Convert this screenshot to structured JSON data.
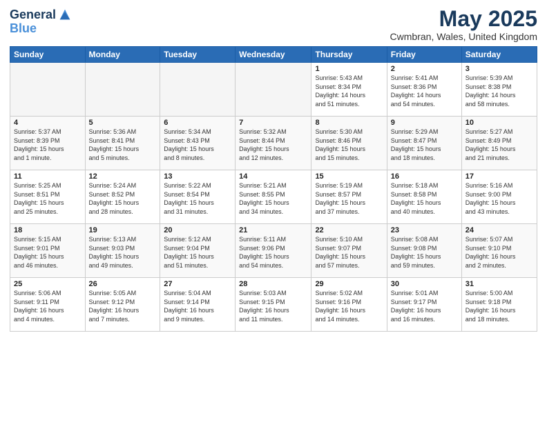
{
  "header": {
    "logo_line1": "General",
    "logo_line2": "Blue",
    "title": "May 2025",
    "subtitle": "Cwmbran, Wales, United Kingdom"
  },
  "days_of_week": [
    "Sunday",
    "Monday",
    "Tuesday",
    "Wednesday",
    "Thursday",
    "Friday",
    "Saturday"
  ],
  "weeks": [
    [
      {
        "day": "",
        "info": ""
      },
      {
        "day": "",
        "info": ""
      },
      {
        "day": "",
        "info": ""
      },
      {
        "day": "",
        "info": ""
      },
      {
        "day": "1",
        "info": "Sunrise: 5:43 AM\nSunset: 8:34 PM\nDaylight: 14 hours\nand 51 minutes."
      },
      {
        "day": "2",
        "info": "Sunrise: 5:41 AM\nSunset: 8:36 PM\nDaylight: 14 hours\nand 54 minutes."
      },
      {
        "day": "3",
        "info": "Sunrise: 5:39 AM\nSunset: 8:38 PM\nDaylight: 14 hours\nand 58 minutes."
      }
    ],
    [
      {
        "day": "4",
        "info": "Sunrise: 5:37 AM\nSunset: 8:39 PM\nDaylight: 15 hours\nand 1 minute."
      },
      {
        "day": "5",
        "info": "Sunrise: 5:36 AM\nSunset: 8:41 PM\nDaylight: 15 hours\nand 5 minutes."
      },
      {
        "day": "6",
        "info": "Sunrise: 5:34 AM\nSunset: 8:43 PM\nDaylight: 15 hours\nand 8 minutes."
      },
      {
        "day": "7",
        "info": "Sunrise: 5:32 AM\nSunset: 8:44 PM\nDaylight: 15 hours\nand 12 minutes."
      },
      {
        "day": "8",
        "info": "Sunrise: 5:30 AM\nSunset: 8:46 PM\nDaylight: 15 hours\nand 15 minutes."
      },
      {
        "day": "9",
        "info": "Sunrise: 5:29 AM\nSunset: 8:47 PM\nDaylight: 15 hours\nand 18 minutes."
      },
      {
        "day": "10",
        "info": "Sunrise: 5:27 AM\nSunset: 8:49 PM\nDaylight: 15 hours\nand 21 minutes."
      }
    ],
    [
      {
        "day": "11",
        "info": "Sunrise: 5:25 AM\nSunset: 8:51 PM\nDaylight: 15 hours\nand 25 minutes."
      },
      {
        "day": "12",
        "info": "Sunrise: 5:24 AM\nSunset: 8:52 PM\nDaylight: 15 hours\nand 28 minutes."
      },
      {
        "day": "13",
        "info": "Sunrise: 5:22 AM\nSunset: 8:54 PM\nDaylight: 15 hours\nand 31 minutes."
      },
      {
        "day": "14",
        "info": "Sunrise: 5:21 AM\nSunset: 8:55 PM\nDaylight: 15 hours\nand 34 minutes."
      },
      {
        "day": "15",
        "info": "Sunrise: 5:19 AM\nSunset: 8:57 PM\nDaylight: 15 hours\nand 37 minutes."
      },
      {
        "day": "16",
        "info": "Sunrise: 5:18 AM\nSunset: 8:58 PM\nDaylight: 15 hours\nand 40 minutes."
      },
      {
        "day": "17",
        "info": "Sunrise: 5:16 AM\nSunset: 9:00 PM\nDaylight: 15 hours\nand 43 minutes."
      }
    ],
    [
      {
        "day": "18",
        "info": "Sunrise: 5:15 AM\nSunset: 9:01 PM\nDaylight: 15 hours\nand 46 minutes."
      },
      {
        "day": "19",
        "info": "Sunrise: 5:13 AM\nSunset: 9:03 PM\nDaylight: 15 hours\nand 49 minutes."
      },
      {
        "day": "20",
        "info": "Sunrise: 5:12 AM\nSunset: 9:04 PM\nDaylight: 15 hours\nand 51 minutes."
      },
      {
        "day": "21",
        "info": "Sunrise: 5:11 AM\nSunset: 9:06 PM\nDaylight: 15 hours\nand 54 minutes."
      },
      {
        "day": "22",
        "info": "Sunrise: 5:10 AM\nSunset: 9:07 PM\nDaylight: 15 hours\nand 57 minutes."
      },
      {
        "day": "23",
        "info": "Sunrise: 5:08 AM\nSunset: 9:08 PM\nDaylight: 15 hours\nand 59 minutes."
      },
      {
        "day": "24",
        "info": "Sunrise: 5:07 AM\nSunset: 9:10 PM\nDaylight: 16 hours\nand 2 minutes."
      }
    ],
    [
      {
        "day": "25",
        "info": "Sunrise: 5:06 AM\nSunset: 9:11 PM\nDaylight: 16 hours\nand 4 minutes."
      },
      {
        "day": "26",
        "info": "Sunrise: 5:05 AM\nSunset: 9:12 PM\nDaylight: 16 hours\nand 7 minutes."
      },
      {
        "day": "27",
        "info": "Sunrise: 5:04 AM\nSunset: 9:14 PM\nDaylight: 16 hours\nand 9 minutes."
      },
      {
        "day": "28",
        "info": "Sunrise: 5:03 AM\nSunset: 9:15 PM\nDaylight: 16 hours\nand 11 minutes."
      },
      {
        "day": "29",
        "info": "Sunrise: 5:02 AM\nSunset: 9:16 PM\nDaylight: 16 hours\nand 14 minutes."
      },
      {
        "day": "30",
        "info": "Sunrise: 5:01 AM\nSunset: 9:17 PM\nDaylight: 16 hours\nand 16 minutes."
      },
      {
        "day": "31",
        "info": "Sunrise: 5:00 AM\nSunset: 9:18 PM\nDaylight: 16 hours\nand 18 minutes."
      }
    ]
  ]
}
